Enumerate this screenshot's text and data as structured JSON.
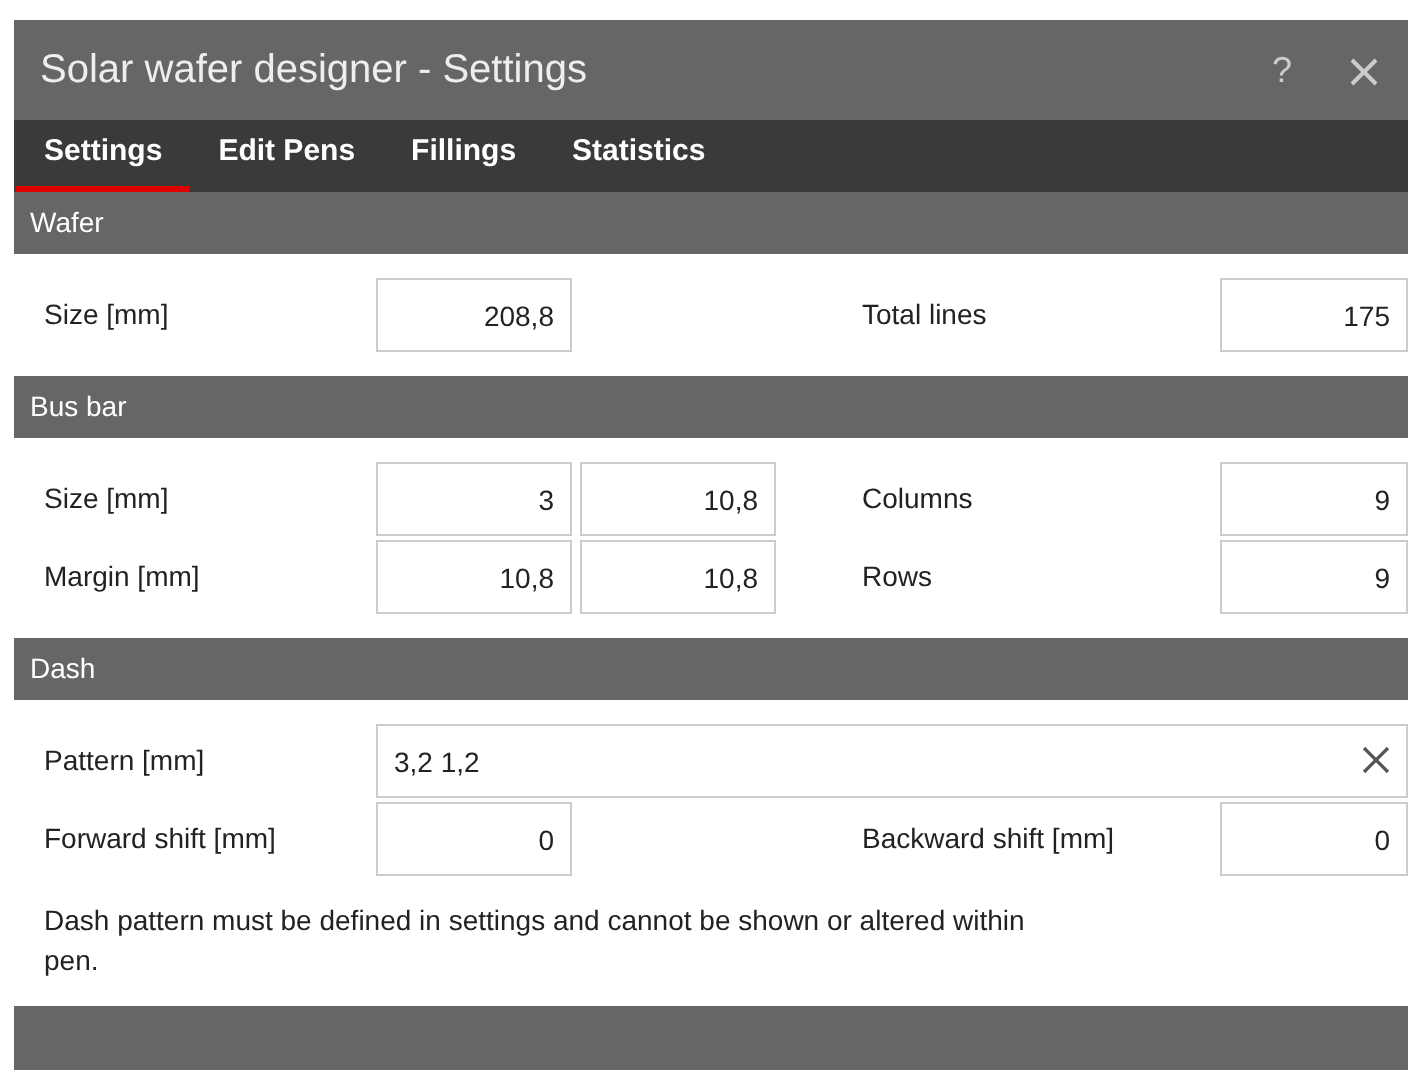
{
  "window": {
    "title": "Solar wafer designer - Settings",
    "help_button": "?"
  },
  "tabs": [
    {
      "label": "Settings",
      "selected": true
    },
    {
      "label": "Edit Pens",
      "selected": false
    },
    {
      "label": "Fillings",
      "selected": false
    },
    {
      "label": "Statistics",
      "selected": false
    }
  ],
  "sections": [
    {
      "title": "Wafer",
      "rows": [
        {
          "kind": "fields",
          "label": "Size [mm]",
          "values": [
            "208,8"
          ],
          "right_label": "Total lines",
          "right_value": "175"
        }
      ]
    },
    {
      "title": "Bus bar",
      "rows": [
        {
          "kind": "fields",
          "label": "Size [mm]",
          "values": [
            "3",
            "10,8"
          ],
          "right_label": "Columns",
          "right_value": "9"
        },
        {
          "kind": "fields",
          "label": "Margin [mm]",
          "values": [
            "10,8",
            "10,8"
          ],
          "right_label": "Rows",
          "right_value": "9"
        }
      ]
    },
    {
      "title": "Dash",
      "rows": [
        {
          "kind": "text",
          "label": "Pattern [mm]",
          "value": "3,2 1,2"
        },
        {
          "kind": "fields",
          "label": "Forward shift [mm]",
          "values": [
            "0"
          ],
          "right_label": "Backward shift [mm]",
          "right_value": "0"
        },
        {
          "kind": "note",
          "text": "Dash pattern must be defined in settings and cannot be shown or altered within pen."
        }
      ]
    }
  ]
}
